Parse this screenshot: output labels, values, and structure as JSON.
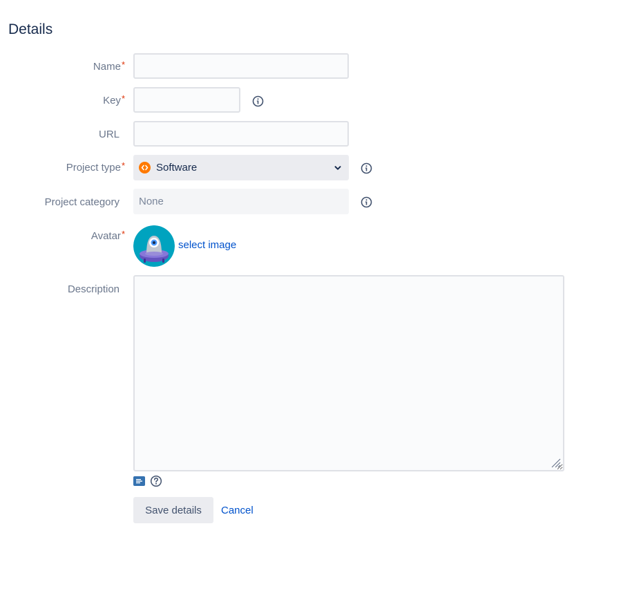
{
  "page": {
    "title": "Details"
  },
  "form": {
    "name": {
      "label": "Name",
      "required_mark": "*",
      "value": ""
    },
    "key": {
      "label": "Key",
      "required_mark": "*",
      "value": ""
    },
    "url": {
      "label": "URL",
      "value": ""
    },
    "project_type": {
      "label": "Project type",
      "required_mark": "*",
      "value": "Software"
    },
    "project_category": {
      "label": "Project category",
      "value": "None"
    },
    "avatar": {
      "label": "Avatar",
      "required_mark": "*",
      "link": "select image"
    },
    "description": {
      "label": "Description",
      "value": ""
    }
  },
  "actions": {
    "save_label": "Save details",
    "cancel_label": "Cancel"
  },
  "colors": {
    "accent": "#0052cc",
    "required": "#de350b",
    "software_icon": "#ff7a00",
    "avatar_bg": "#00a3bf",
    "avatar_body": "#6554c0"
  },
  "icons": {
    "info": "info-icon",
    "chevron": "chevron-down-icon",
    "wiki": "wiki-markup-icon",
    "help": "help-icon",
    "software": "software-project-icon"
  }
}
